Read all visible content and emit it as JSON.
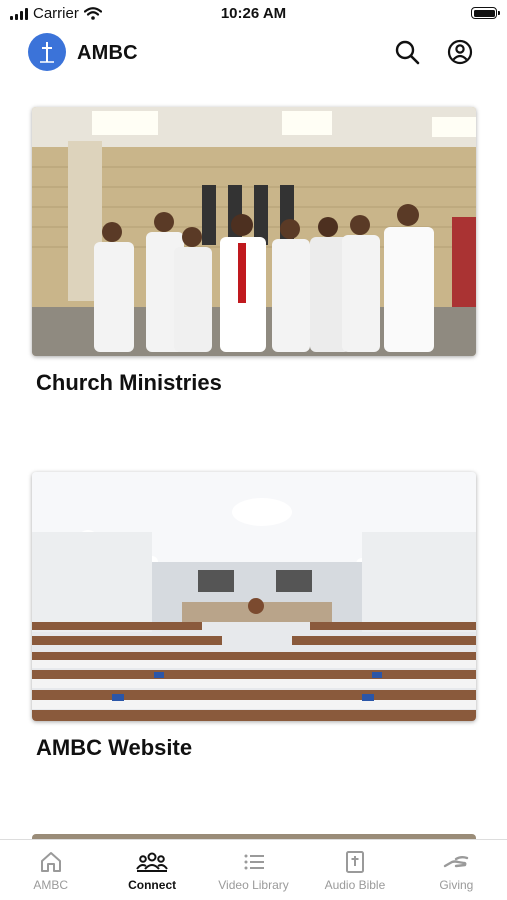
{
  "status": {
    "carrier": "Carrier",
    "time": "10:26 AM"
  },
  "header": {
    "title": "AMBC"
  },
  "cards": [
    {
      "title": "Church Ministries"
    },
    {
      "title": "AMBC Website"
    }
  ],
  "tabs": [
    {
      "label": "AMBC",
      "icon": "home-icon",
      "active": false
    },
    {
      "label": "Connect",
      "icon": "people-group-icon",
      "active": true
    },
    {
      "label": "Video Library",
      "icon": "list-icon",
      "active": false
    },
    {
      "label": "Audio Bible",
      "icon": "bible-icon",
      "active": false
    },
    {
      "label": "Giving",
      "icon": "giving-hand-icon",
      "active": false
    }
  ],
  "colors": {
    "brand": "#3b73d9",
    "active_tab": "#111111",
    "inactive_tab": "#9a9a9a"
  }
}
